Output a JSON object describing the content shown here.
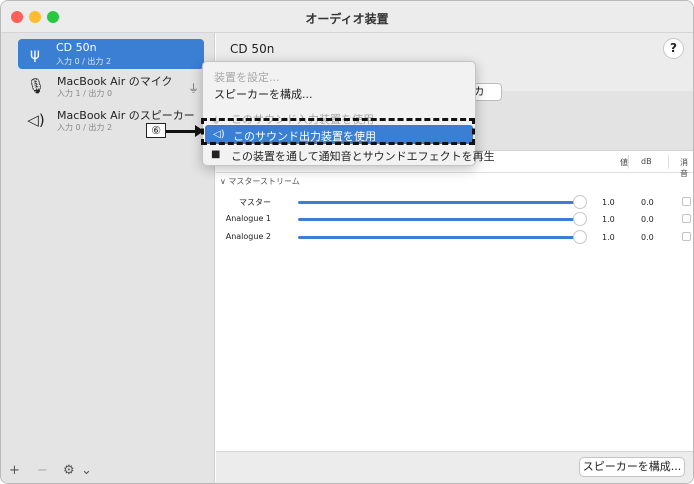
{
  "window": {
    "title": "オーディオ装置"
  },
  "sidebar": {
    "devices": [
      {
        "name": "CD 50n",
        "sub": "入力 0 / 出力 2",
        "icon": "usb-icon",
        "selected": true
      },
      {
        "name": "MacBook Air のマイク",
        "sub": "入力 1 / 出力 0",
        "icon": "microphone-icon"
      },
      {
        "name": "MacBook Air のスピーカー",
        "sub": "入力 0 / 出力 2",
        "icon": "speaker-icon"
      }
    ],
    "footer": {
      "add": "+",
      "remove": "−",
      "gear": "⚙",
      "chevron": "⌄"
    }
  },
  "main": {
    "title": "CD 50n",
    "help": "?",
    "tab_partial": "カ",
    "columns": {
      "value": "値",
      "db": "dB",
      "mute": "消音"
    },
    "section": "∨ マスターストリーム",
    "rows": [
      {
        "label": "マスター",
        "value": "1.0",
        "db": "0.0"
      },
      {
        "label": "Analogue 1",
        "value": "1.0",
        "db": "0.0"
      },
      {
        "label": "Analogue 2",
        "value": "1.0",
        "db": "0.0"
      }
    ],
    "config_button": "スピーカーを構成..."
  },
  "context_menu": {
    "items": [
      {
        "label": "装置を設定...",
        "disabled": true
      },
      {
        "label": "スピーカーを構成...",
        "disabled": false
      },
      {
        "label": "このサウンド入力装置を使用",
        "disabled": true
      },
      {
        "label": "このサウンド出力装置を使用",
        "highlight": true
      },
      {
        "label": "この装置を通して通知音とサウンドエフェクトを再生",
        "disabled": false
      }
    ]
  },
  "annotation": {
    "callout": "⑥"
  },
  "colors": {
    "accent": "#3a7fd4"
  }
}
